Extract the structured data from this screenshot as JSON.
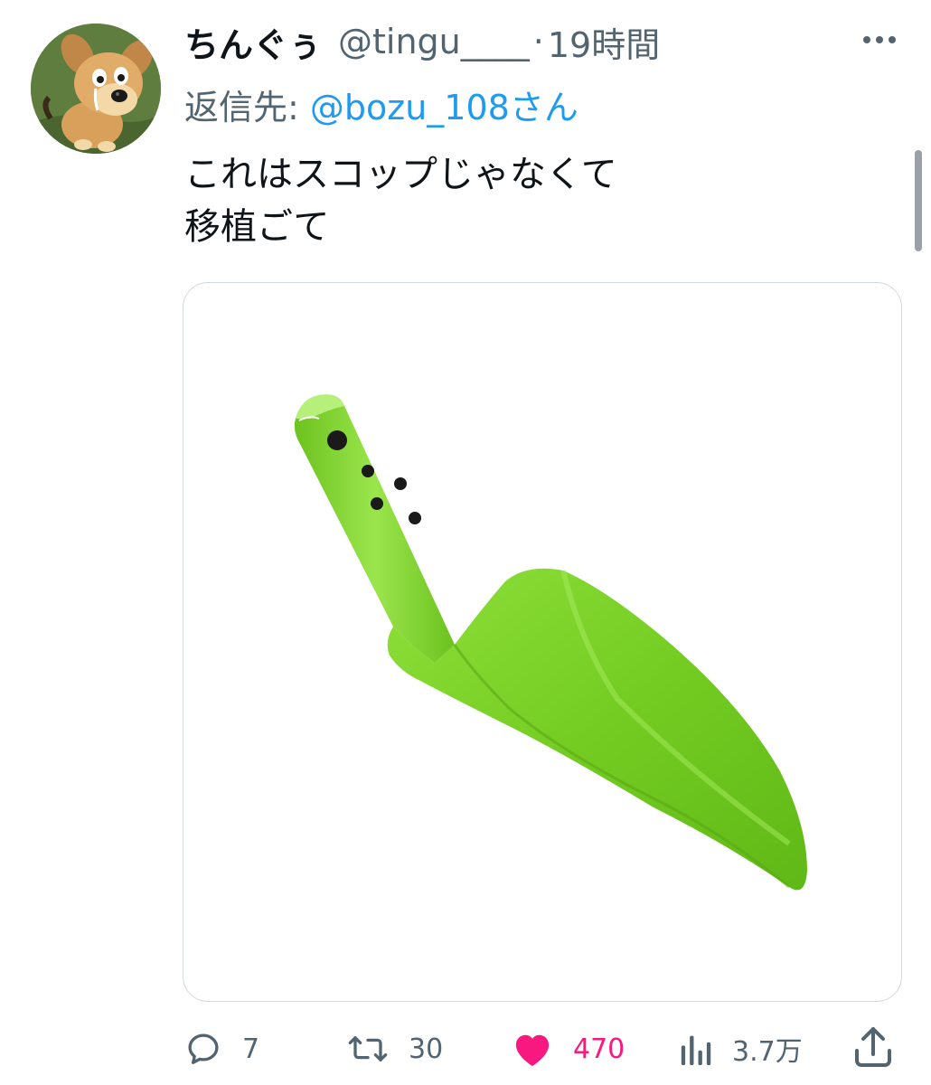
{
  "tweet": {
    "display_name": "ちんぐぅ",
    "handle": "@tingu____",
    "separator": "·",
    "time": "19時間",
    "reply_prefix": "返信先: ",
    "reply_target": "@bozu_108さん",
    "text_lines": [
      "これはスコップじゃなくて",
      "移植ごて"
    ]
  },
  "media": {
    "subject": "green-garden-trowel"
  },
  "actions": {
    "reply_count": "7",
    "retweet_count": "30",
    "like_count": "470",
    "views_count": "3.7万"
  },
  "colors": {
    "text": "#0f1419",
    "secondary": "#536471",
    "link": "#1d9bf0",
    "like": "#f91880",
    "trowel": "#7ed321"
  },
  "icons": {
    "more": "more-icon",
    "reply": "reply-icon",
    "retweet": "retweet-icon",
    "like": "heart-icon",
    "views": "views-icon",
    "share": "share-icon"
  }
}
